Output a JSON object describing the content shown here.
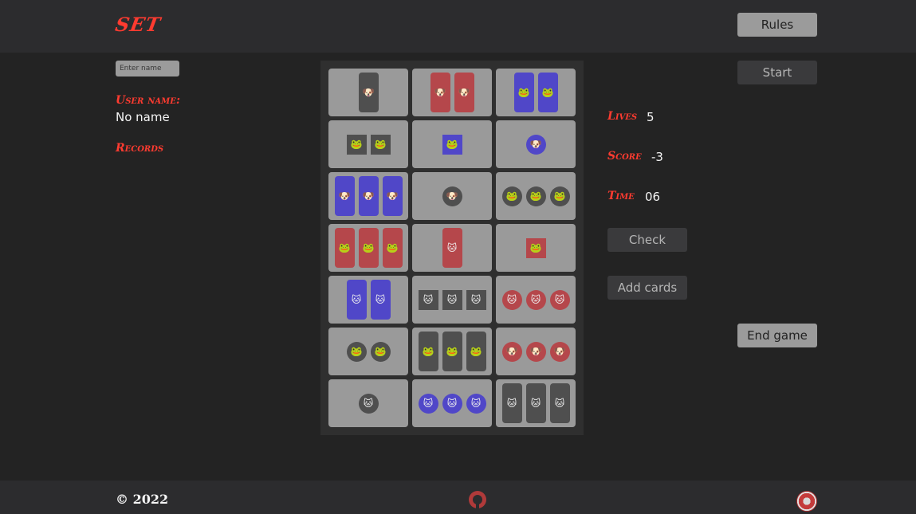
{
  "header": {
    "logo": "SET",
    "rules_label": "Rules"
  },
  "sidebar": {
    "name_placeholder": "Enter name",
    "user_name_label": "User name:",
    "user_name_value": "No name",
    "records_label": "Records"
  },
  "controls": {
    "start_label": "Start",
    "end_game_label": "End game"
  },
  "stats": {
    "lives_label": "Lives",
    "lives_value": "5",
    "score_label": "Score",
    "score_value": "-3",
    "time_label": "Time",
    "time_value": "06",
    "check_label": "Check",
    "add_cards_label": "Add cards"
  },
  "colors": {
    "gray": "#4f4f4f",
    "red": "#b5474b",
    "blue": "#5047c8",
    "card": "#9a9a9a",
    "accent": "#ff3b30"
  },
  "cards": [
    {
      "count": 1,
      "shape": "rect",
      "color": "gray",
      "icon": "🐶"
    },
    {
      "count": 2,
      "shape": "rect",
      "color": "red",
      "icon": "🐶"
    },
    {
      "count": 2,
      "shape": "rect",
      "color": "blue",
      "icon": "🐸"
    },
    {
      "count": 2,
      "shape": "square",
      "color": "gray",
      "icon": "🐸"
    },
    {
      "count": 1,
      "shape": "square",
      "color": "blue",
      "icon": "🐸"
    },
    {
      "count": 1,
      "shape": "circle",
      "color": "blue",
      "icon": "🐶"
    },
    {
      "count": 3,
      "shape": "rect",
      "color": "blue",
      "icon": "🐶"
    },
    {
      "count": 1,
      "shape": "circle",
      "color": "gray",
      "icon": "🐶"
    },
    {
      "count": 3,
      "shape": "circle",
      "color": "gray",
      "icon": "🐸"
    },
    {
      "count": 3,
      "shape": "rect",
      "color": "red",
      "icon": "🐸"
    },
    {
      "count": 1,
      "shape": "rect",
      "color": "red",
      "icon": "🐱"
    },
    {
      "count": 1,
      "shape": "square",
      "color": "red",
      "icon": "🐸"
    },
    {
      "count": 2,
      "shape": "rect",
      "color": "blue",
      "icon": "🐱"
    },
    {
      "count": 3,
      "shape": "square",
      "color": "gray",
      "icon": "🐱"
    },
    {
      "count": 3,
      "shape": "circle",
      "color": "red",
      "icon": "🐱"
    },
    {
      "count": 2,
      "shape": "circle",
      "color": "gray",
      "icon": "🐸"
    },
    {
      "count": 3,
      "shape": "rect",
      "color": "gray",
      "icon": "🐸"
    },
    {
      "count": 3,
      "shape": "circle",
      "color": "red",
      "icon": "🐶"
    },
    {
      "count": 1,
      "shape": "circle",
      "color": "gray",
      "icon": "🐱"
    },
    {
      "count": 3,
      "shape": "circle",
      "color": "blue",
      "icon": "🐱"
    },
    {
      "count": 3,
      "shape": "rect",
      "color": "gray",
      "icon": "🐱"
    }
  ],
  "footer": {
    "copyright": "© 2022"
  }
}
